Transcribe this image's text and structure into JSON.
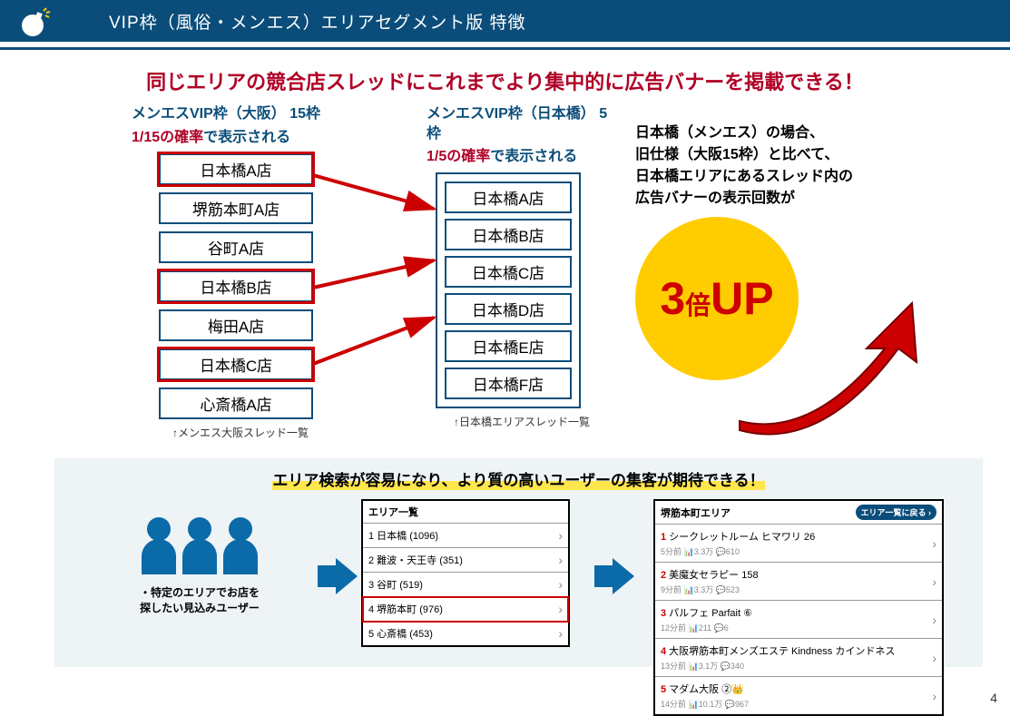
{
  "header": {
    "title": "VIP枠（風俗・メンエス）エリアセグメント版 特徴"
  },
  "subtitle": "同じエリアの競合店スレッドにこれまでより集中的に広告バナーを掲載できる！",
  "left": {
    "title": "メンエスVIP枠（大阪） 15枠",
    "prob": "1/15の確率",
    "prob_suffix": "で表示される",
    "stores": [
      "日本橋A店",
      "堺筋本町A店",
      "谷町A店",
      "日本橋B店",
      "梅田A店",
      "日本橋C店",
      "心斎橋A店"
    ],
    "highlights": [
      0,
      3,
      5
    ],
    "caption": "↑メンエス大阪スレッド一覧"
  },
  "mid": {
    "title": "メンエスVIP枠（日本橋） 5枠",
    "prob": "1/5の確率",
    "prob_suffix": "で表示される",
    "stores": [
      "日本橋A店",
      "日本橋B店",
      "日本橋C店",
      "日本橋D店",
      "日本橋E店",
      "日本橋F店"
    ],
    "caption": "↑日本橋エリアスレッド一覧"
  },
  "right": {
    "lines": [
      "日本橋（メンエス）の場合、",
      "旧仕様（大阪15枠）と比べて、",
      "日本橋エリアにあるスレッド内の",
      "広告バナーの表示回数が"
    ],
    "badge_big": "3",
    "badge_mid": "倍",
    "badge_up": "UP"
  },
  "bottom": {
    "title": "エリア検索が容易になり、より質の高いユーザーの集客が期待できる！",
    "users_caption": "・特定のエリアでお店を\n探したい見込みユーザー",
    "panel_a": {
      "head": "エリア一覧",
      "rows": [
        {
          "label": "1 日本橋 (1096)"
        },
        {
          "label": "2 難波・天王寺 (351)"
        },
        {
          "label": "3 谷町 (519)"
        },
        {
          "label": "4 堺筋本町 (976)",
          "hl": true
        },
        {
          "label": "5 心斎橋 (453)"
        }
      ]
    },
    "panel_b": {
      "head": "堺筋本町エリア",
      "head_pill": "エリア一覧に戻る ›",
      "rows": [
        {
          "rank": "1",
          "name": "シークレットルーム ヒマワリ 26",
          "sub": "5分前 📊3.3万 💬610"
        },
        {
          "rank": "2",
          "name": "美魔女セラピー 158",
          "sub": "9分前 📊3.3万 💬523"
        },
        {
          "rank": "3",
          "name": "パルフェ Parfait ⑥",
          "sub": "12分前 📊211 💬6"
        },
        {
          "rank": "4",
          "name": "大阪堺筋本町メンズエステ Kindness カインドネス",
          "sub": "13分前 📊3.1万 💬340"
        },
        {
          "rank": "5",
          "name": "マダム大阪 ②👑",
          "sub": "14分前 📊10.1万 💬967"
        }
      ]
    }
  },
  "page_number": "4"
}
